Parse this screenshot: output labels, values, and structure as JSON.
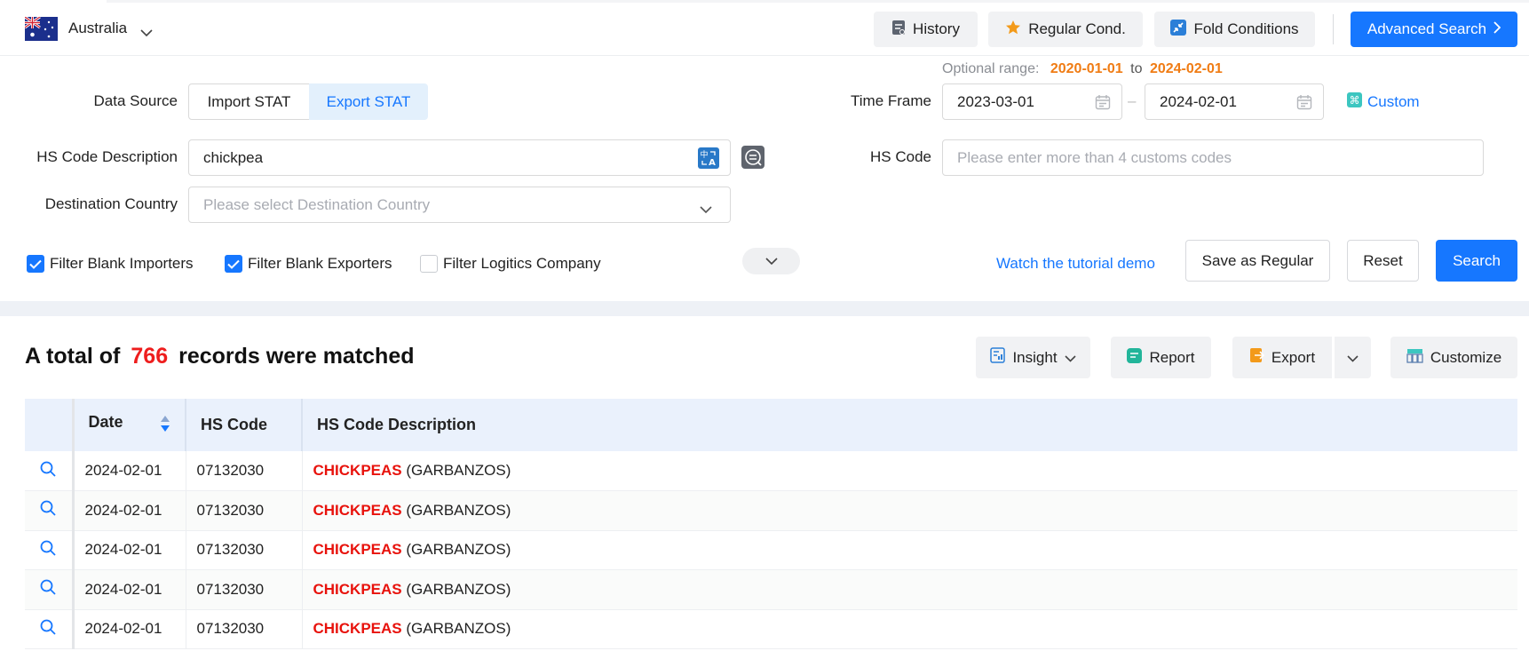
{
  "country": {
    "name": "Australia",
    "flag_icon": "australia-flag-icon"
  },
  "top_actions": {
    "history": "History",
    "regular_cond": "Regular Cond.",
    "fold_conditions": "Fold Conditions",
    "advanced_search": "Advanced Search"
  },
  "optional_range": {
    "label": "Optional range:",
    "start": "2020-01-01",
    "to": "to",
    "end": "2024-02-01"
  },
  "form": {
    "data_source": {
      "label": "Data Source",
      "import": "Import STAT",
      "export": "Export STAT",
      "selected": "Export STAT"
    },
    "time_frame": {
      "label": "Time Frame",
      "start": "2023-03-01",
      "separator": "–",
      "end": "2024-02-01",
      "custom": "Custom"
    },
    "hs_desc": {
      "label": "HS Code Description",
      "value": "chickpea"
    },
    "hs_code": {
      "label": "HS Code",
      "placeholder": "Please enter more than 4 customs codes"
    },
    "destination": {
      "label": "Destination Country",
      "placeholder": "Please select Destination Country"
    },
    "filters": [
      {
        "label": "Filter Blank Importers",
        "checked": true
      },
      {
        "label": "Filter Blank Exporters",
        "checked": true
      },
      {
        "label": "Filter Logitics Company",
        "checked": false
      }
    ],
    "tutorial": "Watch the tutorial demo",
    "save_regular": "Save as Regular",
    "reset": "Reset",
    "search": "Search"
  },
  "results": {
    "prefix": "A total of",
    "count": "766",
    "suffix": "records were matched",
    "insight": "Insight",
    "report": "Report",
    "export": "Export",
    "customize": "Customize"
  },
  "table": {
    "columns": {
      "date": "Date",
      "hs_code": "HS Code",
      "desc": "HS Code Description"
    },
    "rows": [
      {
        "date": "2024-02-01",
        "hs_code": "07132030",
        "highlight": "CHICKPEAS",
        "rest": " (GARBANZOS)"
      },
      {
        "date": "2024-02-01",
        "hs_code": "07132030",
        "highlight": "CHICKPEAS",
        "rest": " (GARBANZOS)"
      },
      {
        "date": "2024-02-01",
        "hs_code": "07132030",
        "highlight": "CHICKPEAS",
        "rest": " (GARBANZOS)"
      },
      {
        "date": "2024-02-01",
        "hs_code": "07132030",
        "highlight": "CHICKPEAS",
        "rest": " (GARBANZOS)"
      },
      {
        "date": "2024-02-01",
        "hs_code": "07132030",
        "highlight": "CHICKPEAS",
        "rest": " (GARBANZOS)"
      }
    ]
  },
  "colors": {
    "accent": "#1677ff",
    "range_date": "#f07c14",
    "count": "#ee1d1d",
    "highlight": "#e8120c"
  }
}
